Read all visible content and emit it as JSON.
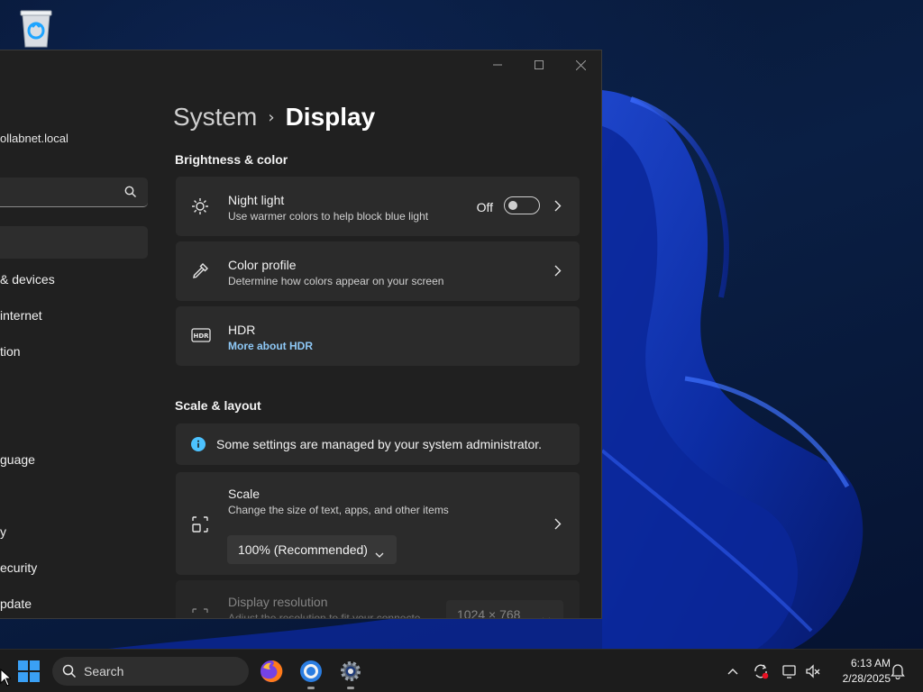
{
  "desktop": {
    "icon": "recycle-bin-icon"
  },
  "window": {
    "controls": [
      "minimize",
      "maximize",
      "close"
    ]
  },
  "nav": {
    "user_email": "ollabnet.local",
    "search_placeholder": "",
    "items": [
      {
        "label": "& devices"
      },
      {
        "label": "internet"
      },
      {
        "label": "tion"
      },
      {
        "label": "guage"
      },
      {
        "label": "y"
      },
      {
        "label": "ecurity"
      },
      {
        "label": "pdate"
      }
    ]
  },
  "breadcrumb": {
    "parent": "System",
    "separator": "›",
    "current": "Display"
  },
  "brightness_section": {
    "title": "Brightness & color",
    "night_light": {
      "title": "Night light",
      "desc": "Use warmer colors to help block blue light",
      "state_label": "Off",
      "on": false
    },
    "color_profile": {
      "title": "Color profile",
      "desc": "Determine how colors appear on your screen"
    },
    "hdr": {
      "title": "HDR",
      "link": "More about HDR"
    }
  },
  "scale_section": {
    "title": "Scale & layout",
    "info": "Some settings are managed by your system administrator.",
    "scale": {
      "title": "Scale",
      "desc": "Change the size of text, apps, and other items",
      "value": "100% (Recommended)"
    },
    "resolution": {
      "title": "Display resolution",
      "desc": "Adjust the resolution to fit your connecte",
      "value": "1024 × 768"
    }
  },
  "taskbar": {
    "search_label": "Search",
    "apps": [
      "firefox-icon",
      "chrome-icon",
      "settings-icon"
    ],
    "clock_time": "6:13 AM",
    "clock_date": "2/28/2025"
  },
  "colors": {
    "accent": "#8ec8f6",
    "window_bg": "#202020",
    "card_bg": "#2b2b2b",
    "info_blue": "#4cc2ff"
  }
}
